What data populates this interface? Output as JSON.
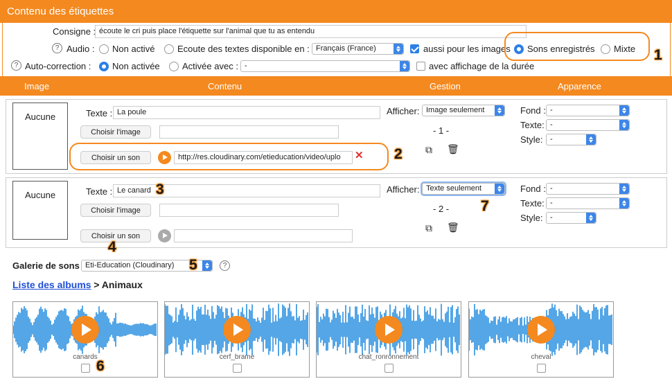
{
  "window": {
    "title": "Contenu des étiquettes"
  },
  "settings": {
    "consigne_label": "Consigne :",
    "consigne_value": "écoute le cri puis place l'étiquette sur l'animal que tu as entendu",
    "audio_label": "Audio :",
    "audio_options": [
      "Non activé",
      "Ecoute des textes disponible en :",
      "Sons enregistrés",
      "Mixte"
    ],
    "audio_language": "Français (France)",
    "also_images_label": "aussi pour les images",
    "autocorrection_label": "Auto-correction :",
    "autocorrection_options": [
      "Non activée",
      "Activée avec :"
    ],
    "autocorrection_value": "-",
    "show_duration_label": "avec affichage de la durée"
  },
  "columns": {
    "image": "Image",
    "contenu": "Contenu",
    "gestion": "Gestion",
    "apparence": "Apparence"
  },
  "labels": {
    "texte": "Texte :",
    "choose_image": "Choisir l'image",
    "choose_sound": "Choisir un son",
    "afficher": "Afficher:",
    "fond": "Fond :",
    "texte_style": "Texte:",
    "style": "Style:",
    "dash": "-"
  },
  "items": [
    {
      "image": "Aucune",
      "text": "La poule",
      "sound_url": "http://res.cloudinary.com/etieducation/video/uplo",
      "display": "Image seulement",
      "index": "- 1 -"
    },
    {
      "image": "Aucune",
      "text": "Le canard",
      "sound_url": "",
      "display": "Texte seulement",
      "index": "- 2 -"
    }
  ],
  "gallery": {
    "label": "Galerie de sons :",
    "source": "Eti-Education (Cloudinary)",
    "breadcrumb_link": "Liste des albums",
    "breadcrumb_rest": "> Animaux",
    "sounds": [
      "canards",
      "cerf_brame",
      "chat_ronronnement",
      "cheval"
    ]
  },
  "callouts": [
    "1",
    "2",
    "3",
    "4",
    "5",
    "6",
    "7"
  ],
  "colors": {
    "accent": "#f4891f",
    "select_blue": "#3d86e8",
    "waveform": "#2a90e0",
    "link": "#1f4fd6"
  }
}
